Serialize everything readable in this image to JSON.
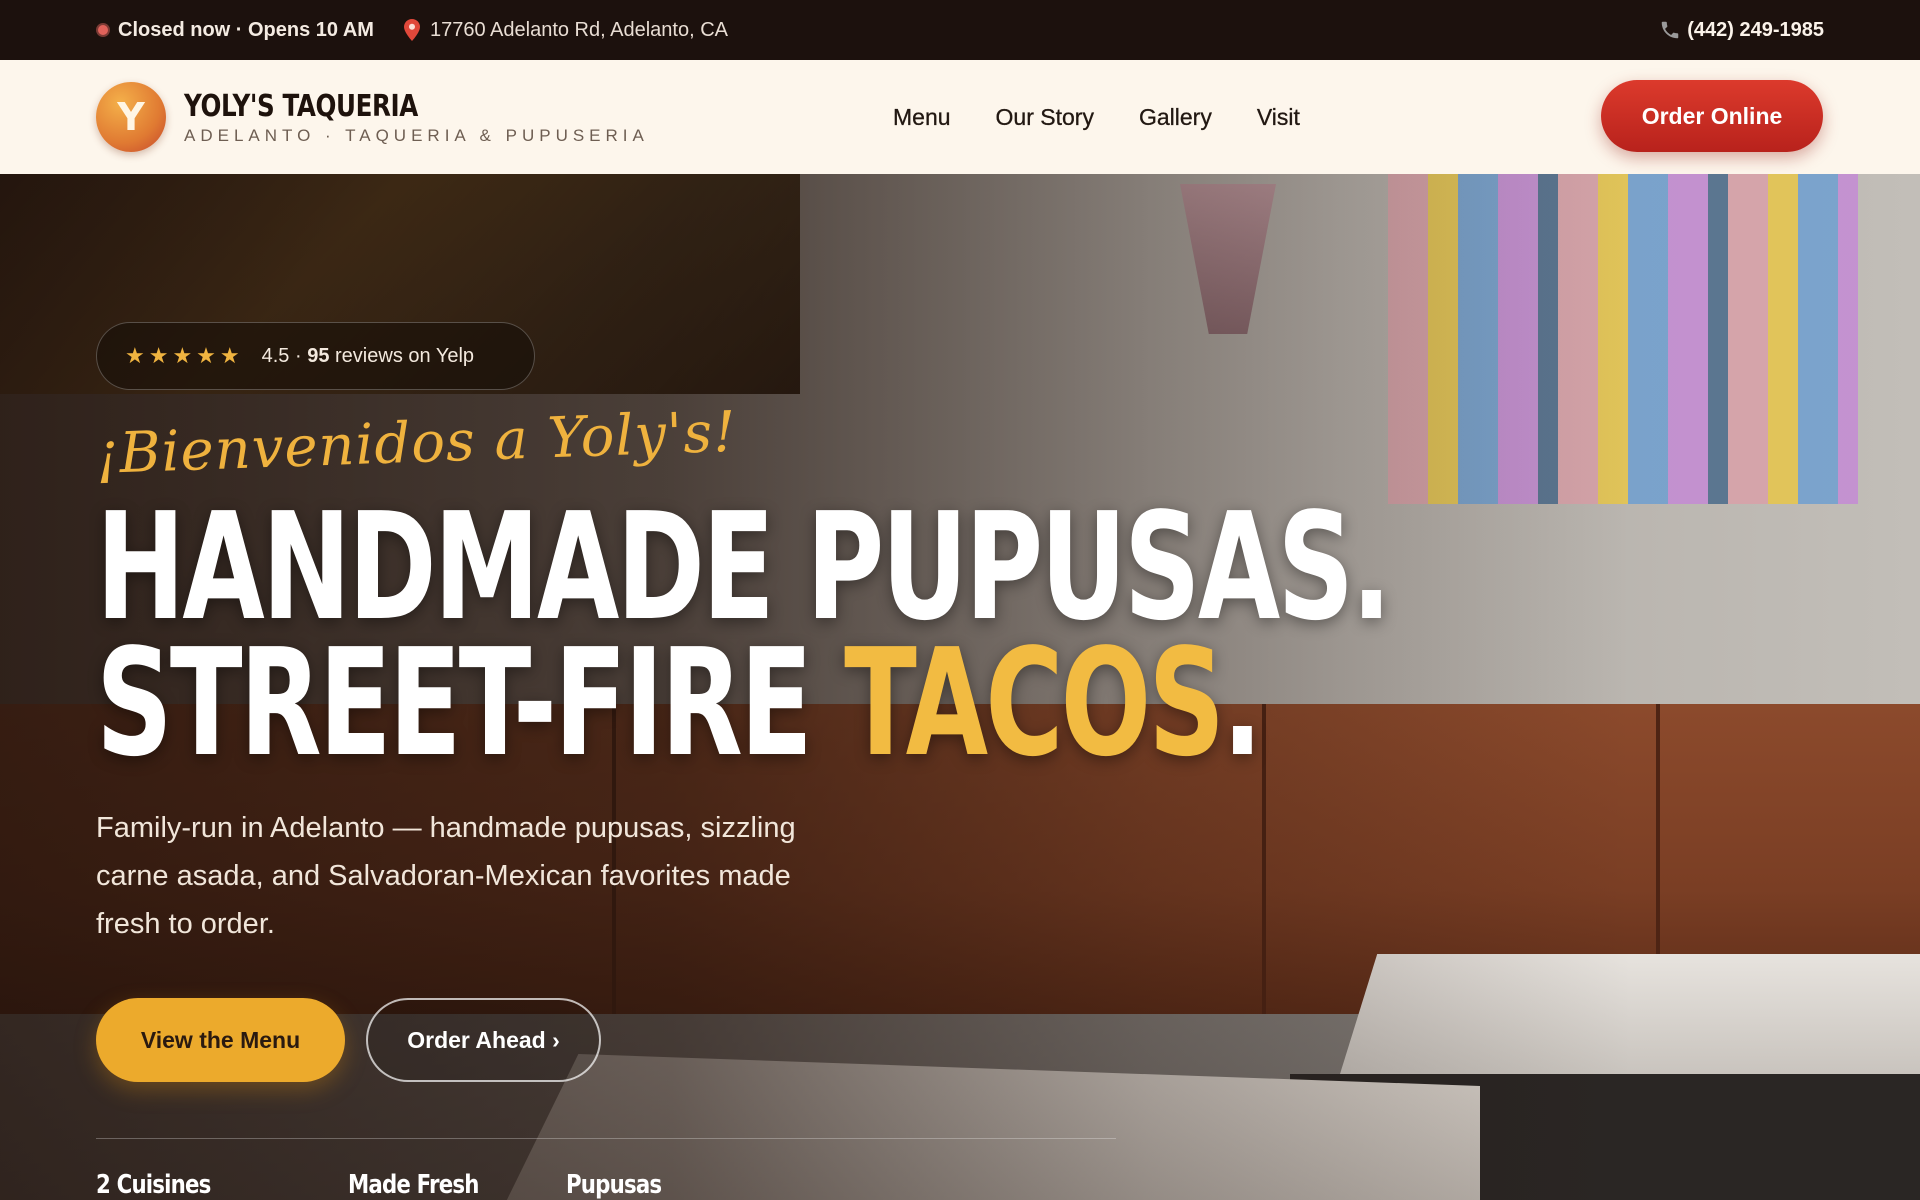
{
  "topbar": {
    "status": "Closed now · Opens 10 AM",
    "address": "17760 Adelanto Rd, Adelanto, CA",
    "phone": "(442) 249-1985",
    "status_color": "#e0625a"
  },
  "brand": {
    "logo_letter": "Y",
    "name": "YOLY'S TAQUERIA",
    "subtitle": "ADELANTO · TAQUERIA & PUPUSERIA"
  },
  "nav": {
    "links": [
      "Menu",
      "Our Story",
      "Gallery",
      "Visit"
    ],
    "order_button": "Order Online"
  },
  "hero": {
    "stars": "★★★★★",
    "rating_value": "4.5",
    "rating_sep": " · ",
    "review_count": "95",
    "review_suffix": " reviews on Yelp",
    "welcome": "¡Bienvenidos a Yoly's!",
    "headline_line1": "HANDMADE PUPUSAS.",
    "headline_line2_prefix": "STREET-FIRE ",
    "headline_line2_accent": "TACOS",
    "headline_line2_suffix": ".",
    "description": "Family-run in Adelanto — handmade pupusas, sizzling carne asada, and Salvadoran-Mexican favorites made fresh to order.",
    "primary_button": "View the Menu",
    "secondary_button": "Order Ahead ›",
    "stats": [
      "2 Cuisines",
      "Made Fresh",
      "Pupusas"
    ]
  },
  "colors": {
    "accent_gold": "#f2bb42",
    "order_red": "#d4332a",
    "nav_bg": "#fdf6ec",
    "topbar_bg": "#1c110d"
  }
}
